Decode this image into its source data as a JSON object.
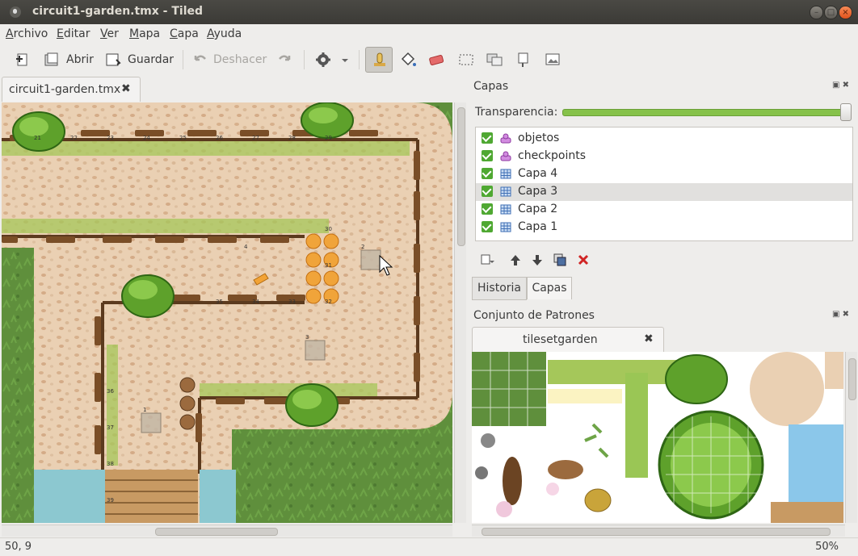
{
  "window": {
    "title": "circuit1-garden.tmx - Tiled"
  },
  "menu": [
    "Archivo",
    "Editar",
    "Ver",
    "Mapa",
    "Capa",
    "Ayuda"
  ],
  "toolbar": {
    "open_label": "Abrir",
    "save_label": "Guardar",
    "undo_label": "Deshacer"
  },
  "editor": {
    "tab_label": "circuit1-garden.tmx",
    "tile_numbers": [
      "21",
      "22",
      "23",
      "24",
      "25",
      "26",
      "27",
      "28",
      "29",
      "30",
      "31",
      "32",
      "33",
      "34",
      "35",
      "36",
      "37",
      "38",
      "39",
      "1",
      "2",
      "3",
      "4"
    ]
  },
  "layers_panel": {
    "title": "Capas",
    "opacity_label": "Transparencia:",
    "opacity": 1.0,
    "layers": [
      {
        "name": "objetos",
        "type": "object",
        "visible": true
      },
      {
        "name": "checkpoints",
        "type": "object",
        "visible": true
      },
      {
        "name": "Capa 4",
        "type": "tile",
        "visible": true
      },
      {
        "name": "Capa 3",
        "type": "tile",
        "visible": true,
        "selected": true
      },
      {
        "name": "Capa 2",
        "type": "tile",
        "visible": true
      },
      {
        "name": "Capa 1",
        "type": "tile",
        "visible": true
      }
    ],
    "tabs": [
      "Historia",
      "Capas"
    ],
    "active_tab": "Capas"
  },
  "tileset_panel": {
    "title": "Conjunto de Patrones",
    "tab_label": "tilesetgarden"
  },
  "status": {
    "coords": "50, 9",
    "zoom": "50%"
  },
  "colors": {
    "accent": "#e0531d",
    "slider": "#86c24a",
    "checkbox": "#4fa832",
    "grass": "#5a8a3a",
    "path": "#e8c7a4",
    "fence": "#5b3a1e",
    "water": "#8cc8d0"
  }
}
